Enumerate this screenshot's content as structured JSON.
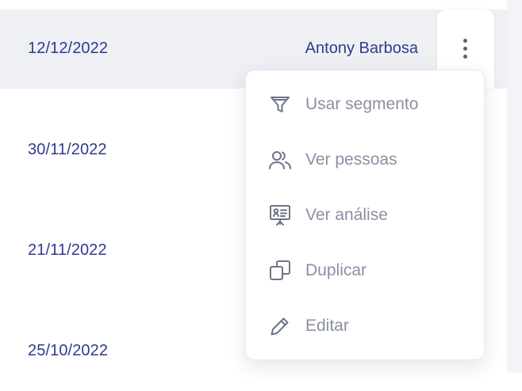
{
  "rows": [
    {
      "date": "12/12/2022",
      "owner": "Antony Barbosa"
    },
    {
      "date": "30/11/2022"
    },
    {
      "date": "21/11/2022"
    },
    {
      "date": "25/10/2022"
    }
  ],
  "row_actions_icon": "kebab-vertical-icon",
  "menu": {
    "items": [
      {
        "label": "Usar segmento",
        "icon": "filter-icon"
      },
      {
        "label": "Ver pessoas",
        "icon": "people-icon"
      },
      {
        "label": "Ver análise",
        "icon": "presentation-chart-icon"
      },
      {
        "label": "Duplicar",
        "icon": "duplicate-icon"
      },
      {
        "label": "Editar",
        "icon": "pencil-icon"
      }
    ]
  },
  "colors": {
    "text_primary": "#2f3a8f",
    "menu_text": "#8a90a2",
    "row_highlight": "#eef0f4",
    "icon": "#5b6172"
  }
}
